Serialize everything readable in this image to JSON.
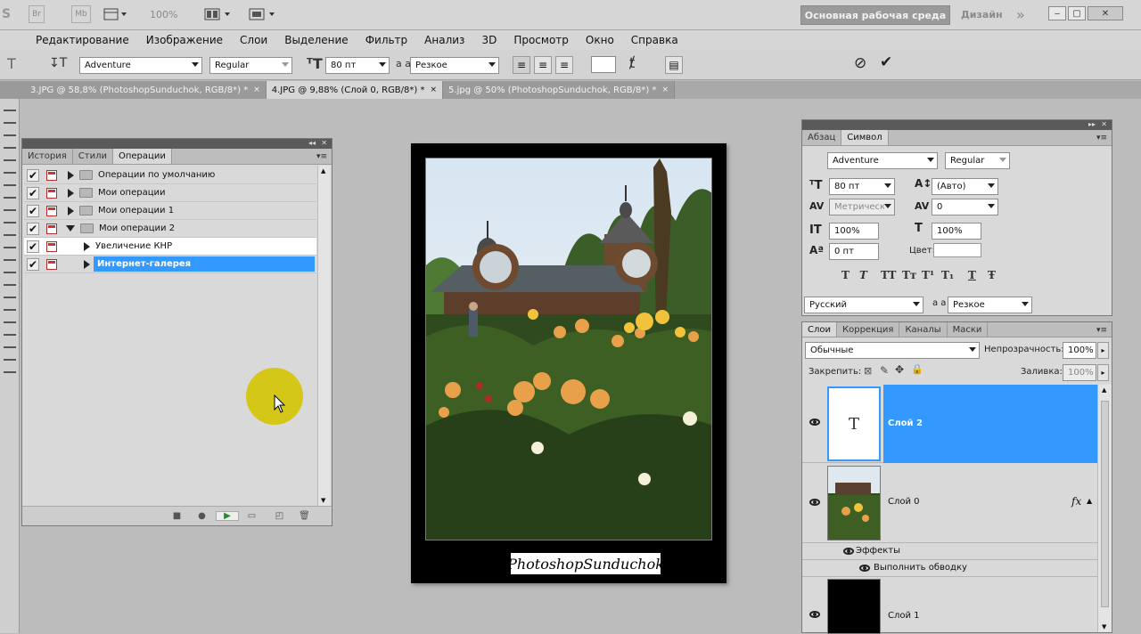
{
  "appbar": {
    "zoom": "100%",
    "workspace_label": "Основная рабочая среда",
    "design_label": "Дизайн",
    "more_label": "»",
    "logo_partial": "S",
    "br_label": "Br",
    "mb_label": "Mb"
  },
  "menu": [
    "Редактирование",
    "Изображение",
    "Слои",
    "Выделение",
    "Фильтр",
    "Анализ",
    "3D",
    "Просмотр",
    "Окно",
    "Справка"
  ],
  "options": {
    "font_family": "Adventure",
    "font_style": "Regular",
    "font_size": "80 пт",
    "antialias_label": "a a",
    "antialias": "Резкое"
  },
  "doc_tabs": [
    {
      "label": "3.JPG @ 58,8% (PhotoshopSunduchok, RGB/8*) *",
      "close": "×"
    },
    {
      "label": "4.JPG @ 9,88% (Слой 0, RGB/8*) *",
      "close": "×"
    },
    {
      "label": "5.jpg @ 50% (PhotoshopSunduchok, RGB/8*) *",
      "close": "×"
    }
  ],
  "actions_panel": {
    "tabs": [
      "История",
      "Стили",
      "Операции"
    ],
    "rows": [
      {
        "label": "Операции по умолчанию"
      },
      {
        "label": "Мои операции"
      },
      {
        "label": "Мои операции 1"
      },
      {
        "label": "Мои операции 2"
      },
      {
        "label": "Увеличение КНР"
      },
      {
        "label": "Интернет-галерея"
      }
    ],
    "check": "✔"
  },
  "document": {
    "watermark": "PhotoshopSunduchok"
  },
  "char_panel": {
    "tabs": [
      "Абзац",
      "Символ"
    ],
    "font_family": "Adventure",
    "font_style": "Regular",
    "size": "80 пт",
    "leading": "(Авто)",
    "kerning": "Метрически",
    "tracking": "0",
    "vscale": "100%",
    "hscale": "100%",
    "baseline": "0 пт",
    "color_label": "Цвет:",
    "language": "Русский",
    "antialias": "Резкое",
    "antialias_label": "a a",
    "type_glyphs": [
      "T",
      "T",
      "TT",
      "Tт",
      "T¹",
      "T₁",
      "T",
      "Ŧ"
    ]
  },
  "layers_panel": {
    "tabs": [
      "Слои",
      "Коррекция",
      "Каналы",
      "Маски"
    ],
    "blend_mode": "Обычные",
    "opacity_label": "Непрозрачность:",
    "opacity": "100%",
    "lock_label": "Закрепить:",
    "fill_label": "Заливка:",
    "fill": "100%",
    "layers": [
      {
        "name": "Слой 2",
        "thumb_text": "T"
      },
      {
        "name": "Слой 0",
        "fx": "fx"
      },
      {
        "name": "Слой 1"
      }
    ],
    "effects_label": "Эффекты",
    "stroke_label": "Выполнить обводку"
  },
  "colors": {
    "selection": "#3399ff",
    "highlight": "#d4c60e"
  }
}
